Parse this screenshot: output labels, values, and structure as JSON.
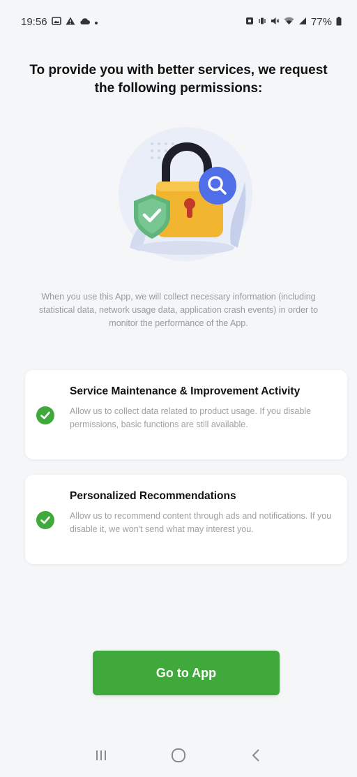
{
  "status_bar": {
    "time": "19:56",
    "battery": "77%",
    "left_icons": [
      "image-icon",
      "warning-icon",
      "cloud-icon",
      "dot-icon"
    ],
    "right_icons": [
      "nfc-icon",
      "vibrate-icon",
      "mute-icon",
      "wifi-icon",
      "signal-icon",
      "battery-icon"
    ]
  },
  "title": "To provide you with better services, we request the following permissions:",
  "intro": "When you use this App, we will collect necessary information (including statistical data, network usage data, application crash events) in order to monitor the performance of the App.",
  "permissions": [
    {
      "title": "Service Maintenance & Improvement Activity",
      "description": "Allow us to collect data related to product usage. If you disable permissions, basic functions are still available.",
      "icon": "check-icon"
    },
    {
      "title": "Personalized Recommendations",
      "description": "Allow us to recommend content through ads and notifications. If you disable it, we won't send what may interest you.",
      "icon": "check-icon"
    }
  ],
  "go_button": {
    "label": "Go to App"
  },
  "colors": {
    "accent": "#3faa3b",
    "lock": "#f2b52f",
    "shield": "#5fb57a",
    "search": "#4f6ee8"
  }
}
